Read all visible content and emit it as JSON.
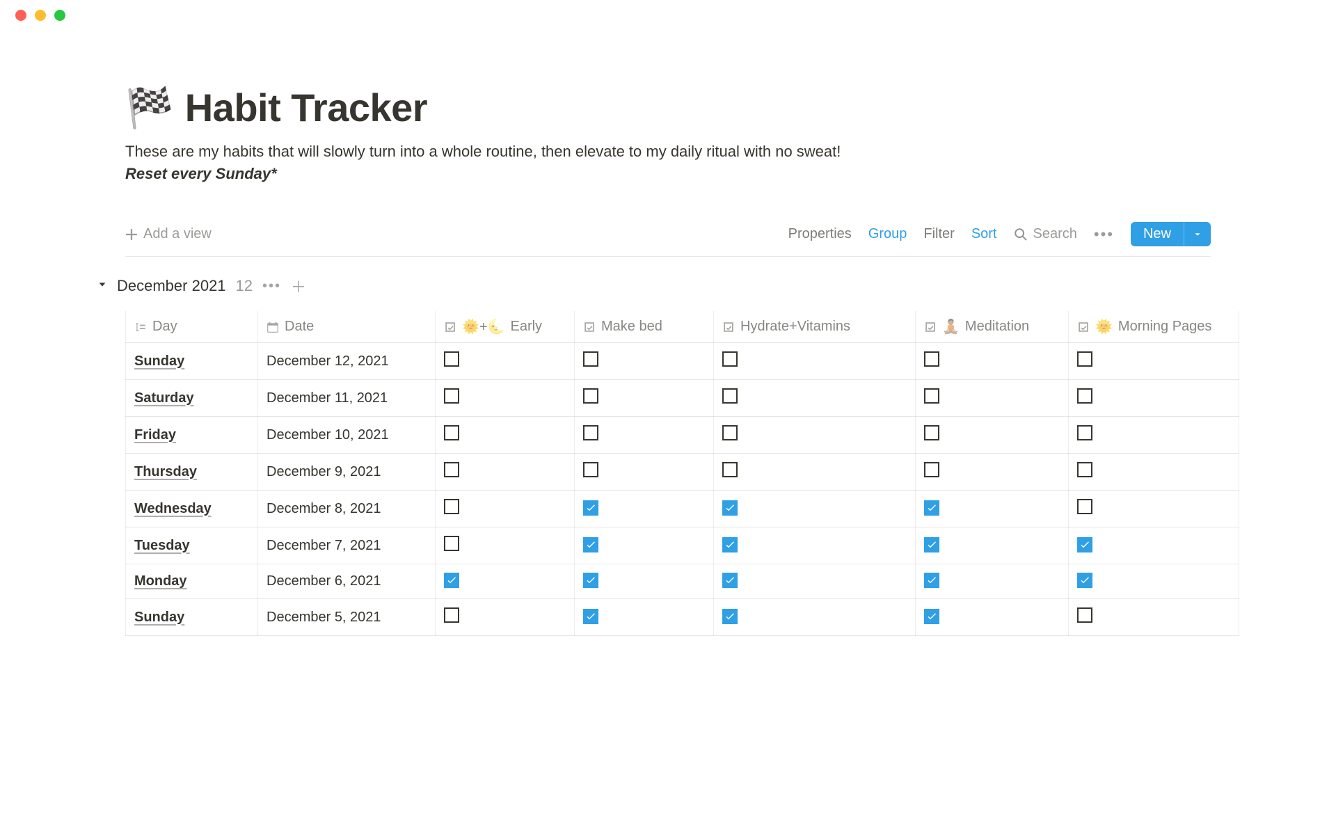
{
  "page": {
    "emoji": "🏁",
    "title": "Habit Tracker",
    "description": "These are my habits that will slowly turn into a whole routine, then elevate to my daily ritual with no sweat!",
    "note": "Reset every Sunday*"
  },
  "toolbar": {
    "add_view": "Add a view",
    "properties": "Properties",
    "group": "Group",
    "filter": "Filter",
    "sort": "Sort",
    "search": "Search",
    "new": "New"
  },
  "group": {
    "name": "December 2021",
    "count": "12"
  },
  "columns": {
    "day": "Day",
    "date": "Date",
    "early_emoji": "🌞+🌜",
    "early": "Early",
    "make_bed": "Make bed",
    "hydrate": "Hydrate+Vitamins",
    "meditation_emoji": "🧘🏽",
    "meditation": "Meditation",
    "morning_emoji": "🌞",
    "morning": "Morning Pages"
  },
  "rows": [
    {
      "day": "Sunday",
      "date": "December 12, 2021",
      "early": false,
      "bed": false,
      "hyd": false,
      "med": false,
      "mp": false
    },
    {
      "day": "Saturday",
      "date": "December 11, 2021",
      "early": false,
      "bed": false,
      "hyd": false,
      "med": false,
      "mp": false
    },
    {
      "day": "Friday",
      "date": "December 10, 2021",
      "early": false,
      "bed": false,
      "hyd": false,
      "med": false,
      "mp": false
    },
    {
      "day": "Thursday",
      "date": "December 9, 2021",
      "early": false,
      "bed": false,
      "hyd": false,
      "med": false,
      "mp": false
    },
    {
      "day": "Wednesday",
      "date": "December 8, 2021",
      "early": false,
      "bed": true,
      "hyd": true,
      "med": true,
      "mp": false
    },
    {
      "day": "Tuesday",
      "date": "December 7, 2021",
      "early": false,
      "bed": true,
      "hyd": true,
      "med": true,
      "mp": true
    },
    {
      "day": "Monday",
      "date": "December 6, 2021",
      "early": true,
      "bed": true,
      "hyd": true,
      "med": true,
      "mp": true
    },
    {
      "day": "Sunday",
      "date": "December 5, 2021",
      "early": false,
      "bed": true,
      "hyd": true,
      "med": true,
      "mp": false
    }
  ]
}
